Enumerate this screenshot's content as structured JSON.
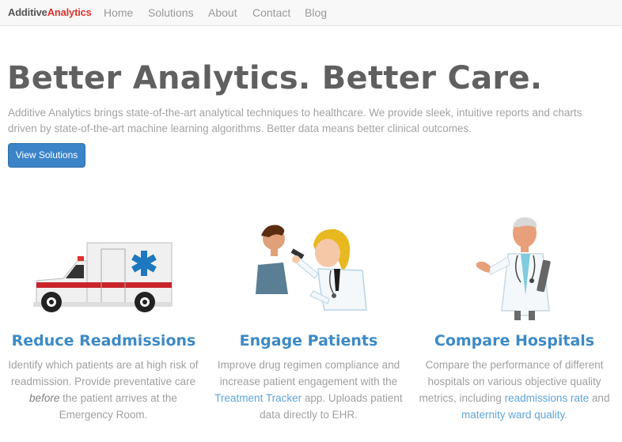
{
  "navbar": {
    "brand_part1": "Additive",
    "brand_part2": "Analytics",
    "links": [
      "Home",
      "Solutions",
      "About",
      "Contact",
      "Blog"
    ]
  },
  "hero": {
    "title": "Better Analytics. Better Care.",
    "text": "Additive Analytics brings state-of-the-art analytical techniques to healthcare. We provide sleek, intuitive reports and charts driven by state-of-the-art machine learning algorithms. Better data means better clinical outcomes.",
    "button_label": "View Solutions"
  },
  "features": [
    {
      "title": "Reduce Readmissions",
      "text_part1": "Identify which patients are at high risk of readmission. Provide preventative care",
      "emphasis": "before",
      "text_part2": "the patient arrives at the Emergency Room."
    },
    {
      "title": "Engage Patients",
      "text_part1": "Improve drug regimen compliance and increase patient engagement with the",
      "link": "Treatment Tracker",
      "text_part2": "app. Uploads patient data directly to EHR."
    },
    {
      "title": "Compare Hospitals",
      "text_part1": "Compare the performance of different hospitals on various objective quality metrics, including",
      "link1": "readmissions rate",
      "text_part2": "and",
      "link2": "maternity ward quality",
      "text_part3": "."
    }
  ],
  "colors": {
    "brand_red": "#d9342b",
    "accent_blue": "#3c8ac6",
    "button_blue": "#3b84c8",
    "link_blue": "#5fa4d9"
  },
  "icons": {
    "feature1": "ambulance-icon",
    "feature2": "doctor-patient-icon",
    "feature3": "doctor-icon"
  }
}
